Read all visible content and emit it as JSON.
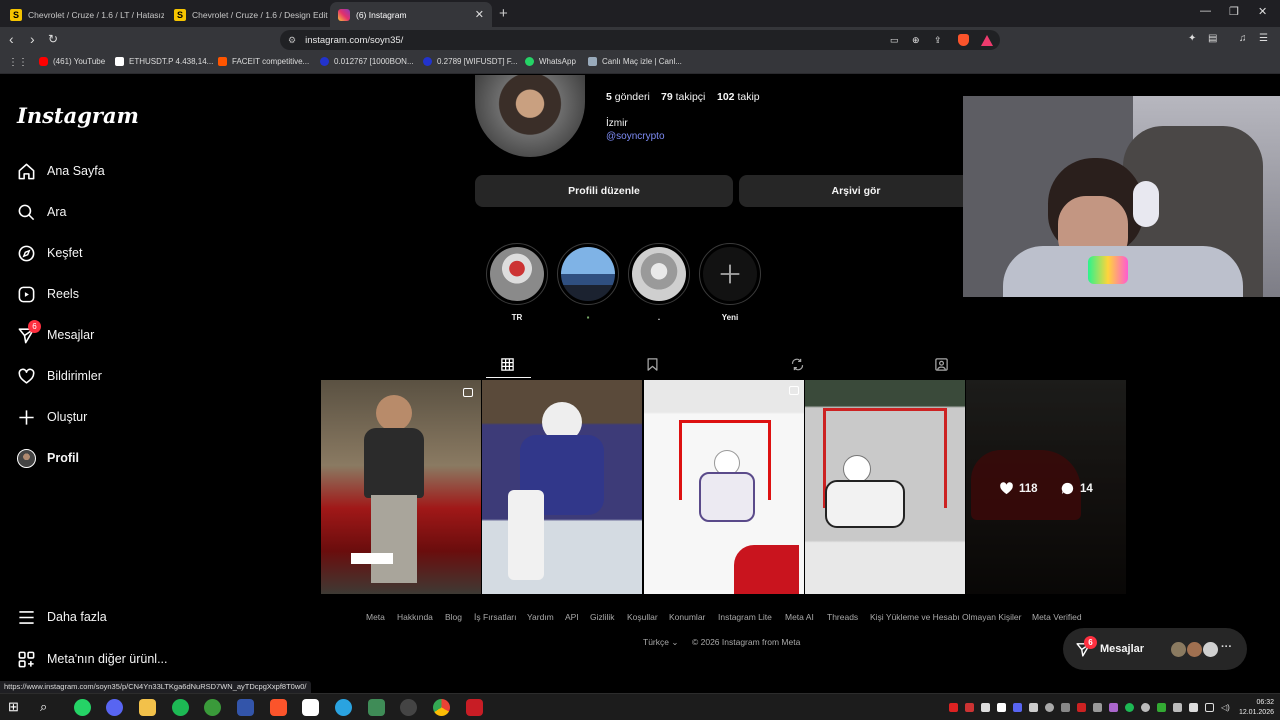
{
  "browser": {
    "tabs": [
      {
        "title": "Chevrolet / Cruze / 1.6 / LT / Hatasız",
        "favicon": "S"
      },
      {
        "title": "Chevrolet / Cruze / 1.6 / Design Editi",
        "favicon": "S"
      },
      {
        "title": "(6) Instagram",
        "favicon": "instagram-icon"
      }
    ],
    "url": "instagram.com/soyn35/",
    "bookmarks": [
      "(461) YouTube",
      "ETHUSDT.P 4.438,14...",
      "FACEIT competitive...",
      "0.012767 [1000BON...",
      "0.2789 [WIFUSDT] F...",
      "WhatsApp",
      "Canlı Maç izle | Canl..."
    ],
    "status_url": "https://www.instagram.com/soyn35/p/CN4Yn33LTKga6dNuRSD7WN_ayTDcpgXxpf8T0w0/"
  },
  "instagram": {
    "logo": "Instagram",
    "nav": [
      {
        "label": "Ana Sayfa",
        "icon": "home-icon"
      },
      {
        "label": "Ara",
        "icon": "search-icon"
      },
      {
        "label": "Keşfet",
        "icon": "compass-icon"
      },
      {
        "label": "Reels",
        "icon": "reels-icon"
      },
      {
        "label": "Mesajlar",
        "icon": "messenger-icon",
        "badge": "6"
      },
      {
        "label": "Bildirimler",
        "icon": "heart-icon"
      },
      {
        "label": "Oluştur",
        "icon": "plus-icon"
      },
      {
        "label": "Profil",
        "icon": "profile-avatar"
      }
    ],
    "more": "Daha fazla",
    "meta_products": "Meta'nın diğer ürünl...",
    "profile": {
      "posts_count": "5",
      "posts_label": "gönderi",
      "followers_count": "79",
      "followers_label": "takipçi",
      "following_count": "102",
      "following_label": "takip",
      "location": "İzmir",
      "mention": "@soyncrypto",
      "edit_profile": "Profili düzenle",
      "view_archive": "Arşivi gör"
    },
    "highlights": [
      {
        "label": "TR"
      },
      {
        "label": "▪"
      },
      {
        "label": "."
      },
      {
        "label": "Yeni"
      }
    ],
    "profile_tabs": [
      "grid-icon",
      "bookmark-icon",
      "repost-icon",
      "tagged-icon"
    ],
    "posts_hover": {
      "likes": "118",
      "comments": "14"
    },
    "footer_links": [
      "Meta",
      "Hakkında",
      "Blog",
      "İş Fırsatları",
      "Yardım",
      "API",
      "Gizlilik",
      "Koşullar",
      "Konumlar",
      "Instagram Lite",
      "Meta AI",
      "Threads",
      "Kişi Yükleme ve Hesabı Olmayan Kişiler",
      "Meta Verified"
    ],
    "language": "Türkçe",
    "copyright": "© 2026 Instagram from Meta",
    "messages_float": {
      "label": "Mesajlar",
      "badge": "6"
    }
  },
  "taskbar": {
    "time": "06:32",
    "date": "12.01.2026"
  }
}
